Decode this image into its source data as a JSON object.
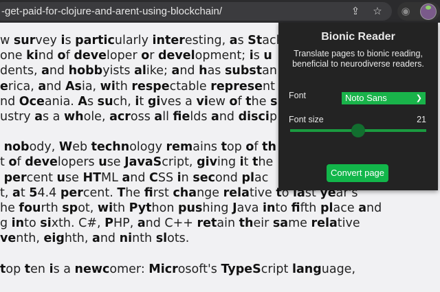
{
  "browser": {
    "url": "-get-paid-for-clojure-and-arent-using-blockchain/",
    "share_icon": "share-icon",
    "bookmark_icon": "star-icon",
    "eye_icon": "eye-icon",
    "extension_icon": "bionic-reader-extension-icon"
  },
  "article": {
    "paragraphs": [
      [
        "w *sur*vey *i*s *partic*ularly *inter*esting, *a*s *St*ack",
        "one *ki*nd *o*f *deve*loper *o*r *devel*opment; *i*s *u*",
        "dents, *a*nd *hobb*yists *al*ike; *a*nd *h*as *subst*an",
        "*e*rica, *a*nd *As*ia, *wi*th *respe*ctable *represe*nt",
        "nd *Oce*ania. *A*s *su*ch, *i*t *gi*ves a *vi*ew *o*f *t*he *s*",
        "ustry *a*s a *wh*ole, *acr*oss *a*ll *fie*lds *a*nd *disci*p"
      ],
      [
        " *nob*ody, *W*eb *techn*ology *rem*ains *t*op *o*f *th*",
        "t *o*f *deve*lopers *u*se *JavaS*cript, *giv*ing *i*t *t*he",
        " *per*cent *u*se *HT*ML *a*nd *C*SS *i*n *sec*ond *pl*ac",
        "t, *a*t *5*4.4 *per*cent. *T*he *fi*rst *cha*nge *rela*tive *t*o *la*st *ye*ar's",
        "he *fou*rth *sp*ot, *wi*th *Pyt*hon *pus*hing *J*ava *in*to *fi*fth *pl*ace *a*nd",
        "g *in*to *si*xth. C#, *P*HP, *a*nd C++ *ret*ain *th*eir *sa*me *rela*tive",
        "*ve*nth, *eig*hth, *a*nd *ni*nth *sl*ots."
      ],
      [
        "*t*op *t*en *i*s a *newc*omer: *Micr*osoft's *TypeS*cript *lang*uage,"
      ]
    ]
  },
  "popup": {
    "title": "Bionic Reader",
    "description": "Translate pages to bionic reading, beneficial to neurodiverse readers.",
    "font_label": "Font",
    "font_value": "Noto Sans",
    "font_size_label": "Font size",
    "font_size_value": "21",
    "font_size_fraction": 0.5,
    "convert_label": "Convert page",
    "accent": "#19b34a"
  }
}
